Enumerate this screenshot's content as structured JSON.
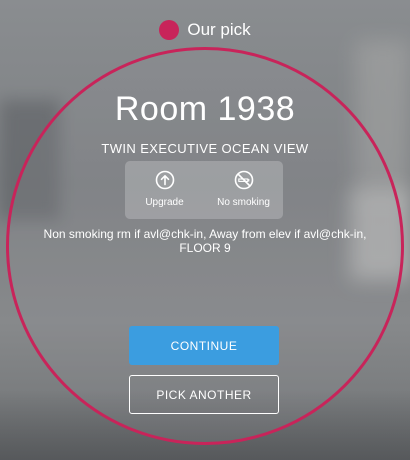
{
  "header": {
    "pick_label": "Our pick"
  },
  "room": {
    "title": "Room 1938",
    "type": "TWIN EXECUTIVE OCEAN VIEW",
    "features": [
      {
        "icon": "upgrade-arrow-icon",
        "label": "Upgrade"
      },
      {
        "icon": "no-smoking-icon",
        "label": "No smoking"
      }
    ],
    "notes": "Non smoking rm if avl@chk-in, Away from elev if avl@chk-in, FLOOR 9"
  },
  "actions": {
    "continue_label": "CONTINUE",
    "pick_another_label": "PICK ANOTHER"
  },
  "colors": {
    "accent": "#c8245a",
    "primary_button": "#3b9de0"
  }
}
